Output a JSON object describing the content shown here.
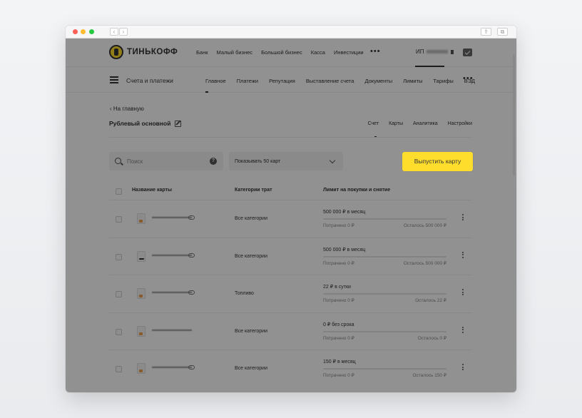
{
  "browser": {
    "back": "‹",
    "forward": "›"
  },
  "header": {
    "logo_text": "ТИНЬКОФФ",
    "products": [
      "Банк",
      "Малый бизнес",
      "Большой бизнес",
      "Касса",
      "Инвестиции"
    ],
    "more": "•••",
    "account_prefix": "ИП"
  },
  "subheader": {
    "title": "Счета и платежи",
    "nav": [
      "Главное",
      "Платежи",
      "Репутация",
      "Выставление счета",
      "Документы",
      "Лимиты",
      "Тарифы",
      "ВЭД"
    ],
    "more": "•••"
  },
  "account": {
    "back_label": "На главную",
    "title": "Рублевый основной",
    "tabs": [
      "Счет",
      "Карты",
      "Аналитика",
      "Настройки"
    ]
  },
  "toolbar": {
    "search_placeholder": "Поиск",
    "help": "?",
    "show_select": "Показывать 50 карт",
    "issue_button": "Выпустить карту"
  },
  "table": {
    "headers": [
      "Название карты",
      "Категории трат",
      "Лимит на покупки и снятие"
    ],
    "rows": [
      {
        "name": "▬▬▬ ▬▬▬▬▬▬",
        "category": "Все категории",
        "limit": "500 000 ₽ в месяц",
        "spent": "Потрачено 0 ₽",
        "left": "Осталось 500 000 ₽"
      },
      {
        "name": "▬▬▬ ▬▬▬▬▬▬",
        "category": "Все категории",
        "limit": "500 000 ₽ в месяц",
        "spent": "Потрачено 0 ₽",
        "left": "Осталось 500 000 ₽"
      },
      {
        "name": "▬▬▬ ▬▬▬▬▬▬",
        "category": "Топливо",
        "limit": "22 ₽ в сутки",
        "spent": "Потрачено 0 ₽",
        "left": "Осталось 22 ₽"
      },
      {
        "name": "▬▬▬▬ ▬▬▬▬▬",
        "category": "Все категории",
        "limit": "0 ₽ без срока",
        "spent": "Потрачено 0 ₽",
        "left": "Осталось 0 ₽"
      },
      {
        "name": "▬▬▬▬▬▬▬ ▬▬",
        "category": "Все категории",
        "limit": "150 ₽ в месяц",
        "spent": "Потрачено 0 ₽",
        "left": "Осталось 150 ₽"
      }
    ]
  },
  "colors": {
    "accent": "#ffdd2d",
    "overlay": "rgba(0,0,0,0.43)"
  }
}
